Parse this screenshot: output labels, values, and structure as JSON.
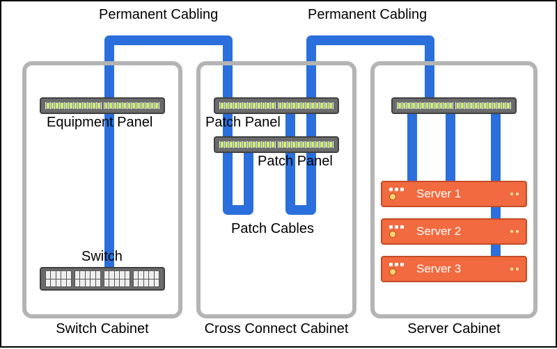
{
  "labels": {
    "perm_cabling_left": "Permanent Cabling",
    "perm_cabling_right": "Permanent Cabling",
    "equipment_panel": "Equipment Panel",
    "patch_panel_top": "Patch Panel",
    "patch_panel_bottom": "Patch Panel",
    "patch_cables": "Patch Cables",
    "switch": "Switch"
  },
  "cabinets": {
    "switch": "Switch Cabinet",
    "cross": "Cross Connect Cabinet",
    "server": "Server Cabinet"
  },
  "servers": [
    "Server 1",
    "Server 2",
    "Server 3"
  ]
}
